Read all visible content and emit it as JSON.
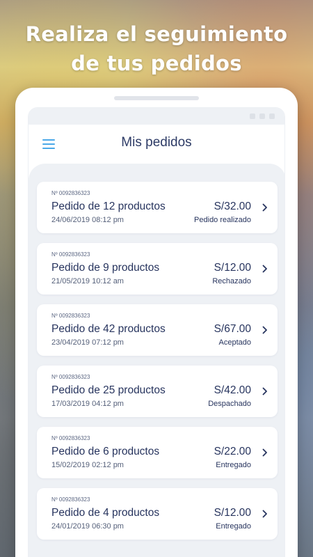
{
  "headline": {
    "line1": "Realiza el seguimiento",
    "line2": "de tus pedidos"
  },
  "app": {
    "title": "Mis pedidos",
    "menu_icon": "hamburger-menu-icon",
    "accent_color": "#4aa8e8",
    "text_color": "#27345e"
  },
  "orders": [
    {
      "number": "Nº 0092836323",
      "title": "Pedido de 12 productos",
      "date": "24/06/2019 08:12 pm",
      "price": "S/32.00",
      "status": "Pedido realizado"
    },
    {
      "number": "Nº 0092836323",
      "title": "Pedido de 9 productos",
      "date": "21/05/2019 10:12 am",
      "price": "S/12.00",
      "status": "Rechazado"
    },
    {
      "number": "Nº 0092836323",
      "title": "Pedido de 42 productos",
      "date": "23/04/2019 07:12 pm",
      "price": "S/67.00",
      "status": "Aceptado"
    },
    {
      "number": "Nº 0092836323",
      "title": "Pedido de 25 productos",
      "date": "17/03/2019 04:12 pm",
      "price": "S/42.00",
      "status": "Despachado"
    },
    {
      "number": "Nº 0092836323",
      "title": "Pedido de 6 productos",
      "date": "15/02/2019 02:12 pm",
      "price": "S/22.00",
      "status": "Entregado"
    },
    {
      "number": "Nº 0092836323",
      "title": "Pedido de 4 productos",
      "date": "24/01/2019 06:30 pm",
      "price": "S/12.00",
      "status": "Entregado"
    }
  ]
}
